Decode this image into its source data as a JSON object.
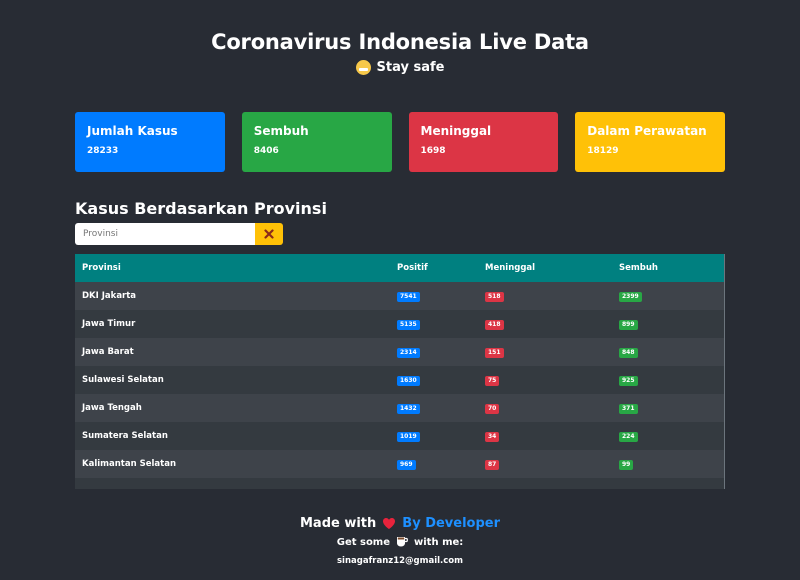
{
  "header": {
    "title": "Coronavirus Indonesia Live Data",
    "subtitle": "Stay safe",
    "subtitle_icon": "grimace-face-icon"
  },
  "summary_cards": [
    {
      "label": "Jumlah Kasus",
      "value": "28233",
      "color": "#007bff"
    },
    {
      "label": "Sembuh",
      "value": "8406",
      "color": "#28a745"
    },
    {
      "label": "Meninggal",
      "value": "1698",
      "color": "#dc3545"
    },
    {
      "label": "Dalam Perawatan",
      "value": "18129",
      "color": "#ffc107"
    }
  ],
  "section": {
    "title": "Kasus Berdasarkan Provinsi",
    "search_placeholder": "Provinsi",
    "search_value": "",
    "clear_icon": "close-icon"
  },
  "table": {
    "columns": [
      "Provinsi",
      "Positif",
      "Meninggal",
      "Sembuh"
    ],
    "rows": [
      {
        "provinsi": "DKI Jakarta",
        "positif": "7541",
        "meninggal": "518",
        "sembuh": "2399"
      },
      {
        "provinsi": "Jawa Timur",
        "positif": "5135",
        "meninggal": "418",
        "sembuh": "899"
      },
      {
        "provinsi": "Jawa Barat",
        "positif": "2314",
        "meninggal": "151",
        "sembuh": "848"
      },
      {
        "provinsi": "Sulawesi Selatan",
        "positif": "1630",
        "meninggal": "75",
        "sembuh": "925"
      },
      {
        "provinsi": "Jawa Tengah",
        "positif": "1432",
        "meninggal": "70",
        "sembuh": "371"
      },
      {
        "provinsi": "Sumatera Selatan",
        "positif": "1019",
        "meninggal": "34",
        "sembuh": "224"
      },
      {
        "provinsi": "Kalimantan Selatan",
        "positif": "969",
        "meninggal": "87",
        "sembuh": "99"
      }
    ],
    "badge_colors": {
      "positif": "#007bff",
      "meninggal": "#dc3545",
      "sembuh": "#28a745"
    },
    "header_color": "#008080"
  },
  "footer": {
    "made_with": "Made with",
    "heart_icon": "heart-icon",
    "developer_link": "By Developer",
    "coffee_prefix": "Get some",
    "coffee_icon": "coffee-icon",
    "coffee_suffix": "with me:",
    "email": "sinagafranz12@gmail.com"
  }
}
